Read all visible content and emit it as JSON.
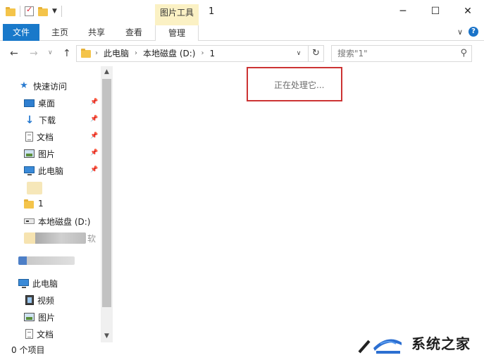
{
  "window": {
    "title": "1",
    "context_tab": "图片工具",
    "minimize_glyph": "─",
    "maximize_glyph": "☐",
    "close_glyph": "✕"
  },
  "ribbon": {
    "tabs": [
      {
        "label": "文件"
      },
      {
        "label": "主页"
      },
      {
        "label": "共享"
      },
      {
        "label": "查看"
      },
      {
        "label": "管理"
      }
    ],
    "help_glyph": "?"
  },
  "address": {
    "breadcrumbs": [
      "此电脑",
      "本地磁盘 (D:)",
      "1"
    ]
  },
  "search": {
    "placeholder": "搜索\"1\""
  },
  "sidebar": {
    "quick_access": "快速访问",
    "quick_items": [
      {
        "label": "桌面",
        "icon": "desktop-icon"
      },
      {
        "label": "下载",
        "icon": "download-icon"
      },
      {
        "label": "文档",
        "icon": "documents-icon"
      },
      {
        "label": "图片",
        "icon": "pictures-icon"
      },
      {
        "label": "此电脑",
        "icon": "computer-icon"
      }
    ],
    "partial_item": "1",
    "drive_item": "本地磁盘 (D:)",
    "partial_item_2": "软",
    "this_pc": "此电脑",
    "pc_items": [
      {
        "label": "视频",
        "icon": "video-icon"
      },
      {
        "label": "图片",
        "icon": "pictures-icon"
      },
      {
        "label": "文档",
        "icon": "documents-icon"
      }
    ]
  },
  "content": {
    "status_message": "正在处理它..."
  },
  "statusbar": {
    "item_count": "0 个项目"
  },
  "watermark": {
    "text": "系统之家"
  },
  "colors": {
    "file_tab": "#1979ca",
    "context_tab": "#fbf1c4",
    "highlight_border": "#cc3333"
  }
}
